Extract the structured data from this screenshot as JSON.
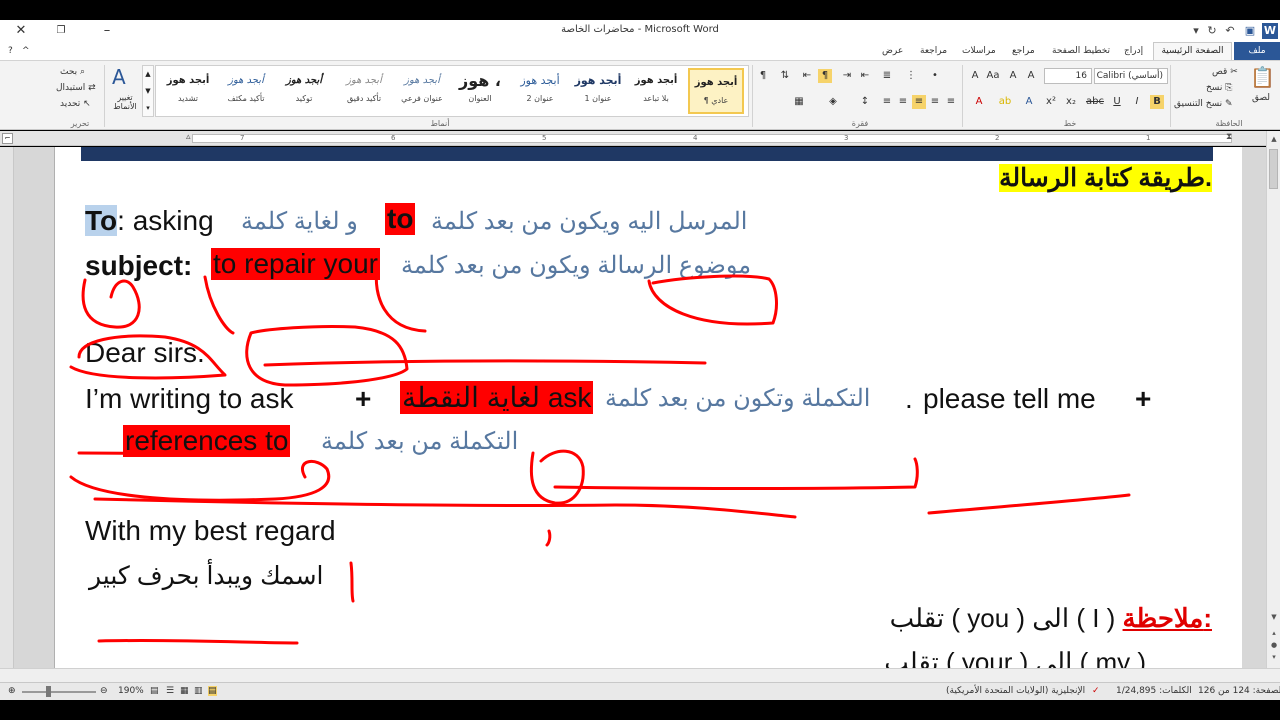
{
  "window": {
    "title": "محاضرات الخاصة - Microsoft Word"
  },
  "tabs": [
    {
      "label": "ملف"
    },
    {
      "label": "الصفحة الرئيسية"
    },
    {
      "label": "إدراج"
    },
    {
      "label": "تخطيط الصفحة"
    },
    {
      "label": "مراجع"
    },
    {
      "label": "مراسلات"
    },
    {
      "label": "مراجعة"
    },
    {
      "label": "عرض"
    }
  ],
  "ribbon": {
    "clipboard": {
      "paste": "لصق",
      "cut": "قص",
      "copy": "نسخ",
      "format_painter": "نسخ التنسيق",
      "group": "الحافظة"
    },
    "font": {
      "name": "Calibri (أساسي)",
      "size": "16",
      "group": "خط",
      "bold": "B",
      "italic": "I",
      "underline": "U"
    },
    "paragraph": {
      "group": "فقرة"
    },
    "styles": {
      "group": "أنماط",
      "change_styles": "تغيير الأنماط",
      "items": [
        {
          "sample": "أبجد هوز",
          "name": "¶ عادي"
        },
        {
          "sample": "أبجد هوز",
          "name": "بلا تباعد"
        },
        {
          "sample": "أبجد هوز",
          "name": "عنوان 1"
        },
        {
          "sample": "أبجد هوز",
          "name": "عنوان 2"
        },
        {
          "sample": "هوز ،",
          "name": "العنوان"
        },
        {
          "sample": "أبجد هوز",
          "name": "عنوان فرعي"
        },
        {
          "sample": "أبجد هوز",
          "name": "تأكيد دقيق"
        },
        {
          "sample": "أبجد هوز",
          "name": "توكيد"
        },
        {
          "sample": "أبجد هوز",
          "name": "تأكيد مكثف"
        },
        {
          "sample": "أبجد هوز",
          "name": "تشديد"
        }
      ]
    },
    "editing": {
      "find": "بحث",
      "replace": "استبدال",
      "select": "تحديد",
      "group": "تحرير"
    }
  },
  "ruler": {
    "ticks": [
      "1",
      "2",
      "3",
      "4",
      "5",
      "6",
      "7"
    ]
  },
  "document": {
    "heading": "طريقة كتابة الرسالة.",
    "line_to": {
      "label": "To",
      "rest": ": asking",
      "ar1": "و لغاية كلمة",
      "hl": "to",
      "ar2": "المرسل اليه ويكون من بعد كلمة"
    },
    "line_subject": {
      "label": "subject:",
      "hl": "to repair your",
      "ar": "موضوع الرسالة ويكون من بعد كلمة"
    },
    "dear": "Dear sirs.",
    "line_writing": {
      "en": "I’m writing to ask",
      "plus1": "+",
      "hl": "لغاية النقطة ask",
      "ar": "التكملة وتكون من بعد كلمة",
      "dot": ".",
      "en2": "please tell me",
      "plus2": "+"
    },
    "line_refs": {
      "hl": "references to",
      "ar": "التكملة من بعد كلمة"
    },
    "regards": "With my best regard",
    "name_line": "اسمك ويبدأ بحرف كبير",
    "note": {
      "label": "ملاحظة:",
      "text1": "تقلب ( you ) الى ( I )",
      "text2": "تقلب ( your ) الى ( my )"
    }
  },
  "status": {
    "page": "الصفحة: 124 من 126",
    "words": "الكلمات: 1/24,895",
    "language": "الإنجليزية (الولايات المتحدة الأمريكية)",
    "zoom": "190%"
  },
  "colors": {
    "file_tab": "#2b5797",
    "highlight_red": "#ff0000",
    "highlight_yellow": "#ffff00",
    "arabic_text": "#5778a0",
    "annotation_red": "#ff0000"
  }
}
